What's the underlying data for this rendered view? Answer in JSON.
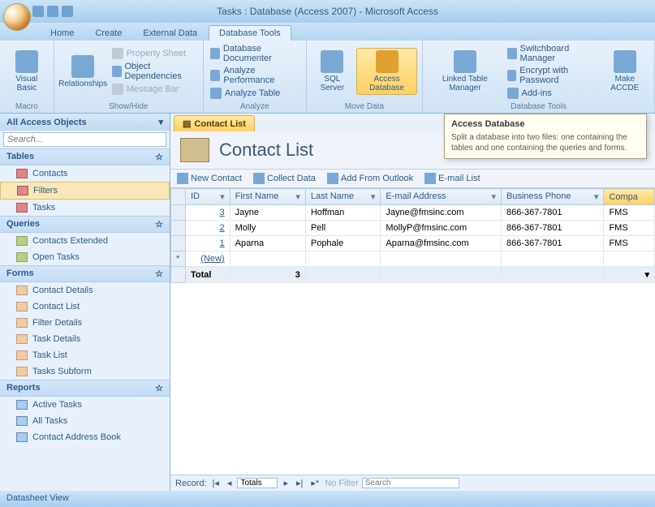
{
  "window": {
    "title": "Tasks : Database (Access 2007) - Microsoft Access"
  },
  "ribbon_tabs": {
    "home": "Home",
    "create": "Create",
    "external": "External Data",
    "dbtools": "Database Tools"
  },
  "ribbon": {
    "macro": {
      "visual_basic": "Visual\nBasic",
      "label": "Macro"
    },
    "showhide": {
      "relationships": "Relationships",
      "prop_sheet": "Property Sheet",
      "obj_dep": "Object Dependencies",
      "msg_bar": "Message Bar",
      "label": "Show/Hide"
    },
    "analyze": {
      "documenter": "Database Documenter",
      "performance": "Analyze Performance",
      "table": "Analyze Table",
      "label": "Analyze"
    },
    "movedata": {
      "sql": "SQL\nServer",
      "access": "Access\nDatabase",
      "label": "Move Data"
    },
    "dbtools": {
      "linked": "Linked Table\nManager",
      "switchboard": "Switchboard Manager",
      "encrypt": "Encrypt with Password",
      "addins": "Add-ins",
      "make_accde": "Make\nACCDE",
      "label": "Database Tools"
    }
  },
  "nav": {
    "header": "All Access Objects",
    "search_placeholder": "Search...",
    "tables": {
      "label": "Tables",
      "items": [
        "Contacts",
        "Filters",
        "Tasks"
      ]
    },
    "queries": {
      "label": "Queries",
      "items": [
        "Contacts Extended",
        "Open Tasks"
      ]
    },
    "forms": {
      "label": "Forms",
      "items": [
        "Contact Details",
        "Contact List",
        "Filter Details",
        "Task Details",
        "Task List",
        "Tasks Subform"
      ]
    },
    "reports": {
      "label": "Reports",
      "items": [
        "Active Tasks",
        "All Tasks",
        "Contact Address Book"
      ]
    }
  },
  "doc": {
    "tab": "Contact List",
    "title": "Contact List",
    "toolbar": {
      "new_contact": "New Contact",
      "collect": "Collect Data",
      "outlook": "Add From Outlook",
      "email": "E-mail List"
    }
  },
  "grid": {
    "cols": {
      "id": "ID",
      "first": "First Name",
      "last": "Last Name",
      "email": "E-mail Address",
      "phone": "Business Phone",
      "company": "Compa"
    },
    "rows": [
      {
        "id": "3",
        "first": "Jayne",
        "last": "Hoffman",
        "email": "Jayne@fmsinc.com",
        "phone": "866-367-7801",
        "company": "FMS"
      },
      {
        "id": "2",
        "first": "Molly",
        "last": "Pell",
        "email": "MollyP@fmsinc.com",
        "phone": "866-367-7801",
        "company": "FMS"
      },
      {
        "id": "1",
        "first": "Aparna",
        "last": "Pophale",
        "email": "Aparna@fmsinc.com",
        "phone": "866-367-7801",
        "company": "FMS"
      }
    ],
    "new_label": "(New)",
    "total_label": "Total",
    "total_count": "3"
  },
  "tooltip": {
    "title": "Access Database",
    "body": "Split a database into two files: one containing the tables and one containing the queries and forms."
  },
  "recordnav": {
    "label": "Record:",
    "current": "Totals",
    "nofilter": "No Filter",
    "search": "Search"
  },
  "statusbar": "Datasheet View"
}
